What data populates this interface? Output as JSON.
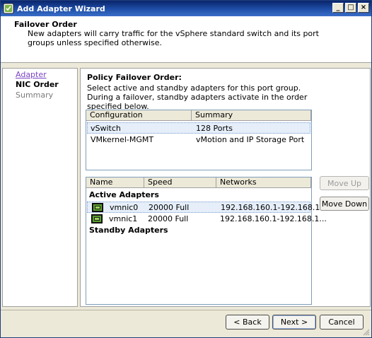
{
  "window": {
    "title": "Add Adapter Wizard",
    "buttons": {
      "minimize": "_",
      "maximize": "□",
      "close": "×"
    }
  },
  "header": {
    "title": "Failover Order",
    "description": "New adapters will carry traffic for the vSphere standard switch and its port groups unless specified otherwise."
  },
  "nav": {
    "items": [
      {
        "label": "Adapter",
        "state": "link"
      },
      {
        "label": "NIC Order",
        "state": "current"
      },
      {
        "label": "Summary",
        "state": "disabled"
      }
    ]
  },
  "policy": {
    "title": "Policy Failover Order:",
    "description": "Select active and standby adapters for this port group. During a failover, standby adapters activate in the order specified below."
  },
  "config_table": {
    "columns": [
      "Configuration",
      "Summary"
    ],
    "rows": [
      {
        "configuration": "vSwitch",
        "summary": "128 Ports",
        "selected": true
      },
      {
        "configuration": "VMkernel-MGMT",
        "summary": "vMotion and IP Storage Port",
        "selected": false
      }
    ]
  },
  "adapter_table": {
    "columns": [
      "Name",
      "Speed",
      "Networks"
    ],
    "groups": {
      "active": "Active Adapters",
      "standby": "Standby Adapters"
    },
    "active_rows": [
      {
        "name": "vmnic0",
        "speed": "20000 Full",
        "networks": "192.168.160.1-192.168.1...",
        "selected": true
      },
      {
        "name": "vmnic1",
        "speed": "20000 Full",
        "networks": "192.168.160.1-192.168.1...",
        "selected": false
      }
    ]
  },
  "side_buttons": {
    "move_up": "Move Up",
    "move_down": "Move Down"
  },
  "footer": {
    "back": "< Back",
    "next": "Next >",
    "cancel": "Cancel"
  },
  "colors": {
    "titlebar": "#0a246a",
    "nav_link": "#7b44c6",
    "selection": "#e5eef9"
  }
}
